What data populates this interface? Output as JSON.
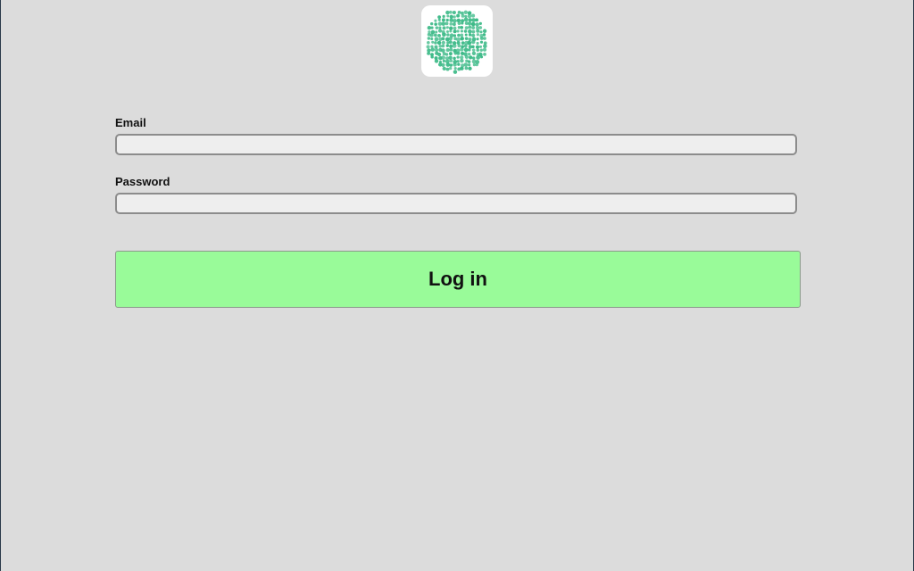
{
  "logo": {
    "icon": "dotted-circle-logo-icon",
    "color": "#3dba88"
  },
  "form": {
    "email_label": "Email",
    "email_value": "",
    "password_label": "Password",
    "password_value": "",
    "login_label": "Log in"
  },
  "colors": {
    "background": "#dcdcdc",
    "button": "#99fb99",
    "input": "#eeeeee"
  }
}
